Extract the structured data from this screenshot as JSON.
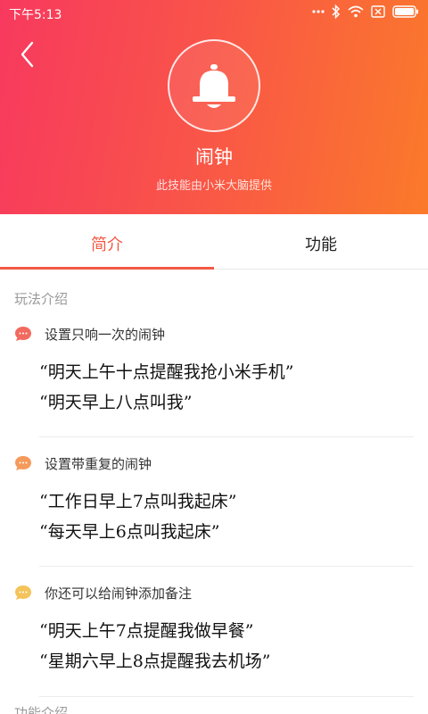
{
  "status_bar": {
    "time": "下午5:13"
  },
  "header": {
    "title": "闹钟",
    "subtitle": "此技能由小米大脑提供",
    "gradient_start": "#f7395e",
    "gradient_end": "#fb7a2a"
  },
  "tabs": [
    {
      "label": "简介",
      "active": true
    },
    {
      "label": "功能",
      "active": false
    }
  ],
  "section_title": "玩法介绍",
  "blocks": [
    {
      "title": "设置只响一次的闹钟",
      "bubble_color": "#f26a5f",
      "quotes": [
        "“明天上午十点提醒我抢小米手机”",
        "“明天早上八点叫我”"
      ]
    },
    {
      "title": "设置带重复的闹钟",
      "bubble_color": "#f59a5a",
      "quotes": [
        "“工作日早上7点叫我起床”",
        "“每天早上6点叫我起床”"
      ]
    },
    {
      "title": "你还可以给闹钟添加备注",
      "bubble_color": "#f4c45a",
      "quotes": [
        "“明天上午7点提醒我做早餐”",
        "“星期六早上8点提醒我去机场”"
      ]
    }
  ],
  "next_section_title": "功能介绍",
  "accent_color": "#f25a44"
}
